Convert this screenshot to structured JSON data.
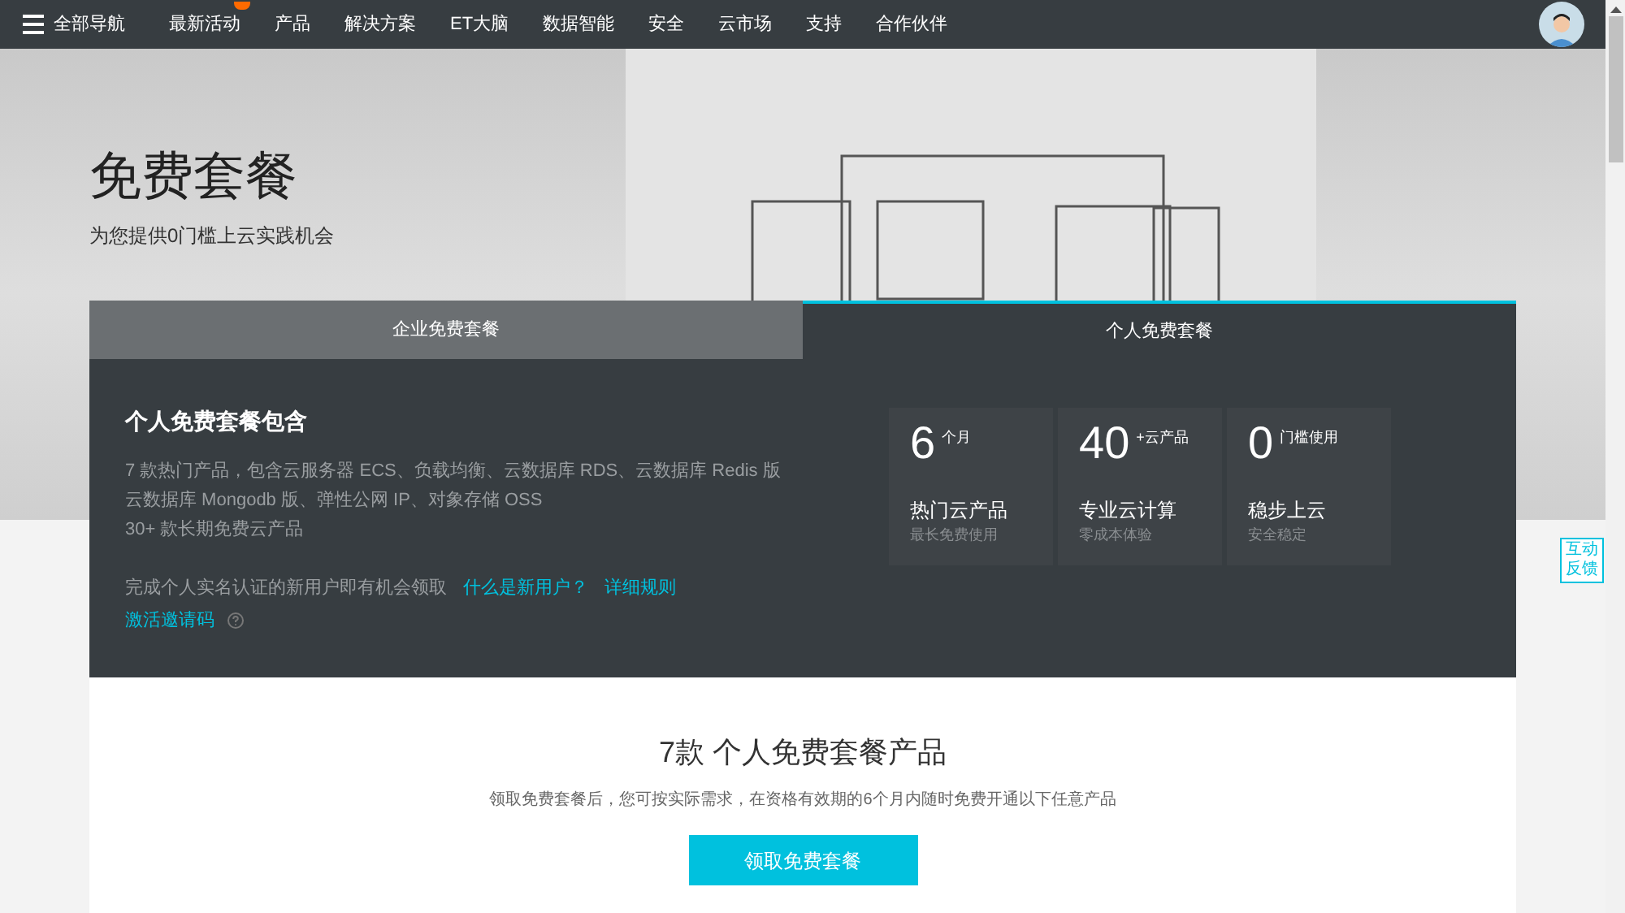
{
  "nav": {
    "menu_label": "全部导航",
    "items": [
      {
        "label": "最新活动",
        "badge": true
      },
      {
        "label": "产品",
        "badge": false
      },
      {
        "label": "解决方案",
        "badge": false
      },
      {
        "label": "ET大脑",
        "badge": false
      },
      {
        "label": "数据智能",
        "badge": false
      },
      {
        "label": "安全",
        "badge": false
      },
      {
        "label": "云市场",
        "badge": false
      },
      {
        "label": "支持",
        "badge": false
      },
      {
        "label": "合作伙伴",
        "badge": false
      }
    ]
  },
  "hero": {
    "title": "免费套餐",
    "subtitle": "为您提供0门槛上云实践机会"
  },
  "tabs": [
    {
      "label": "企业免费套餐",
      "selected": false
    },
    {
      "label": "个人免费套餐",
      "selected": true
    }
  ],
  "panel": {
    "heading": "个人免费套餐包含",
    "lines": [
      "7 款热门产品，包含云服务器 ECS、负载均衡、云数据库 RDS、云数据库 Redis 版",
      "云数据库 Mongodb 版、弹性公网 IP、对象存储 OSS",
      "30+ 款长期免费云产品"
    ],
    "note": "完成个人实名认证的新用户即有机会领取",
    "links": [
      "什么是新用户？",
      "详细规则"
    ],
    "activate_link": "激活邀请码",
    "stats": [
      {
        "number": "6",
        "unit": "个月",
        "title": "热门云产品",
        "caption": "最长免费使用"
      },
      {
        "number": "40",
        "unit": "+云产品",
        "title": "专业云计算",
        "caption": "零成本体验"
      },
      {
        "number": "0",
        "unit": "门槛使用",
        "title": "稳步上云",
        "caption": "安全稳定"
      }
    ]
  },
  "products": {
    "heading": "7款 个人免费套餐产品",
    "description": "领取免费套餐后，您可按实际需求，在资格有效期的6个月内随时免费开通以下任意产品",
    "button": "领取免费套餐"
  },
  "feedback": {
    "lines": [
      "互动",
      "反馈"
    ]
  }
}
